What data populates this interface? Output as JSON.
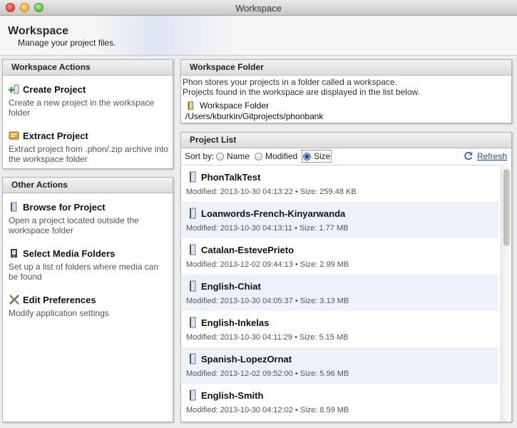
{
  "window": {
    "title": "Workspace"
  },
  "header": {
    "title": "Workspace",
    "subtitle": "Manage your project files."
  },
  "workspace_actions": {
    "heading": "Workspace Actions",
    "items": [
      {
        "label": "Create Project",
        "description": "Create a new project in the workspace folder",
        "icon": "add-folder-icon"
      },
      {
        "label": "Extract Project",
        "description": "Extract project from .phon/.zip archive into the workspace folder",
        "icon": "archive-icon"
      }
    ]
  },
  "other_actions": {
    "heading": "Other Actions",
    "items": [
      {
        "label": "Browse for Project",
        "description": "Open a project located outside the workspace folder",
        "icon": "folder-icon"
      },
      {
        "label": "Select Media Folders",
        "description": "Set up a list of folders where media can be found",
        "icon": "media-folder-icon"
      },
      {
        "label": "Edit Preferences",
        "description": "Modify application settings",
        "icon": "tools-icon"
      }
    ]
  },
  "workspace_folder": {
    "heading": "Workspace Folder",
    "line1": "Phon stores your projects in a folder called a workspace.",
    "line2": "Projects found in the workspace are displayed in the list below.",
    "link_label": "Workspace Folder",
    "path": "/Users/kburkin/Gitprojects/phonbank"
  },
  "project_list": {
    "heading": "Project List",
    "sort_label": "Sort by:",
    "sort_options": [
      "Name",
      "Modified",
      "Size"
    ],
    "sort_selected": "Size",
    "refresh_label": "Refresh",
    "projects": [
      {
        "name": "PhonTalkTest",
        "meta": "Modified: 2013-10-30 04:13:22 • Size: 259.48 KB"
      },
      {
        "name": "Loanwords-French-Kinyarwanda",
        "meta": "Modified: 2013-10-30 04:13:11 • Size: 1.77 MB"
      },
      {
        "name": "Catalan-EstevePrieto",
        "meta": "Modified: 2013-12-02 09:44:13 • Size: 2.99 MB"
      },
      {
        "name": "English-Chiat",
        "meta": "Modified: 2013-10-30 04:05:37 • Size: 3.13 MB"
      },
      {
        "name": "English-Inkelas",
        "meta": "Modified: 2013-10-30 04:11:29 • Size: 5.15 MB"
      },
      {
        "name": "Spanish-LopezOrnat",
        "meta": "Modified: 2013-12-02 09:52:00 • Size: 5.96 MB"
      },
      {
        "name": "English-Smith",
        "meta": "Modified: 2013-10-30 04:12:02 • Size: 8.59 MB"
      }
    ]
  },
  "colors": {
    "link": "#1c4fa8",
    "row_alt": "#edf2fa",
    "accent": "#3a6ab8"
  }
}
